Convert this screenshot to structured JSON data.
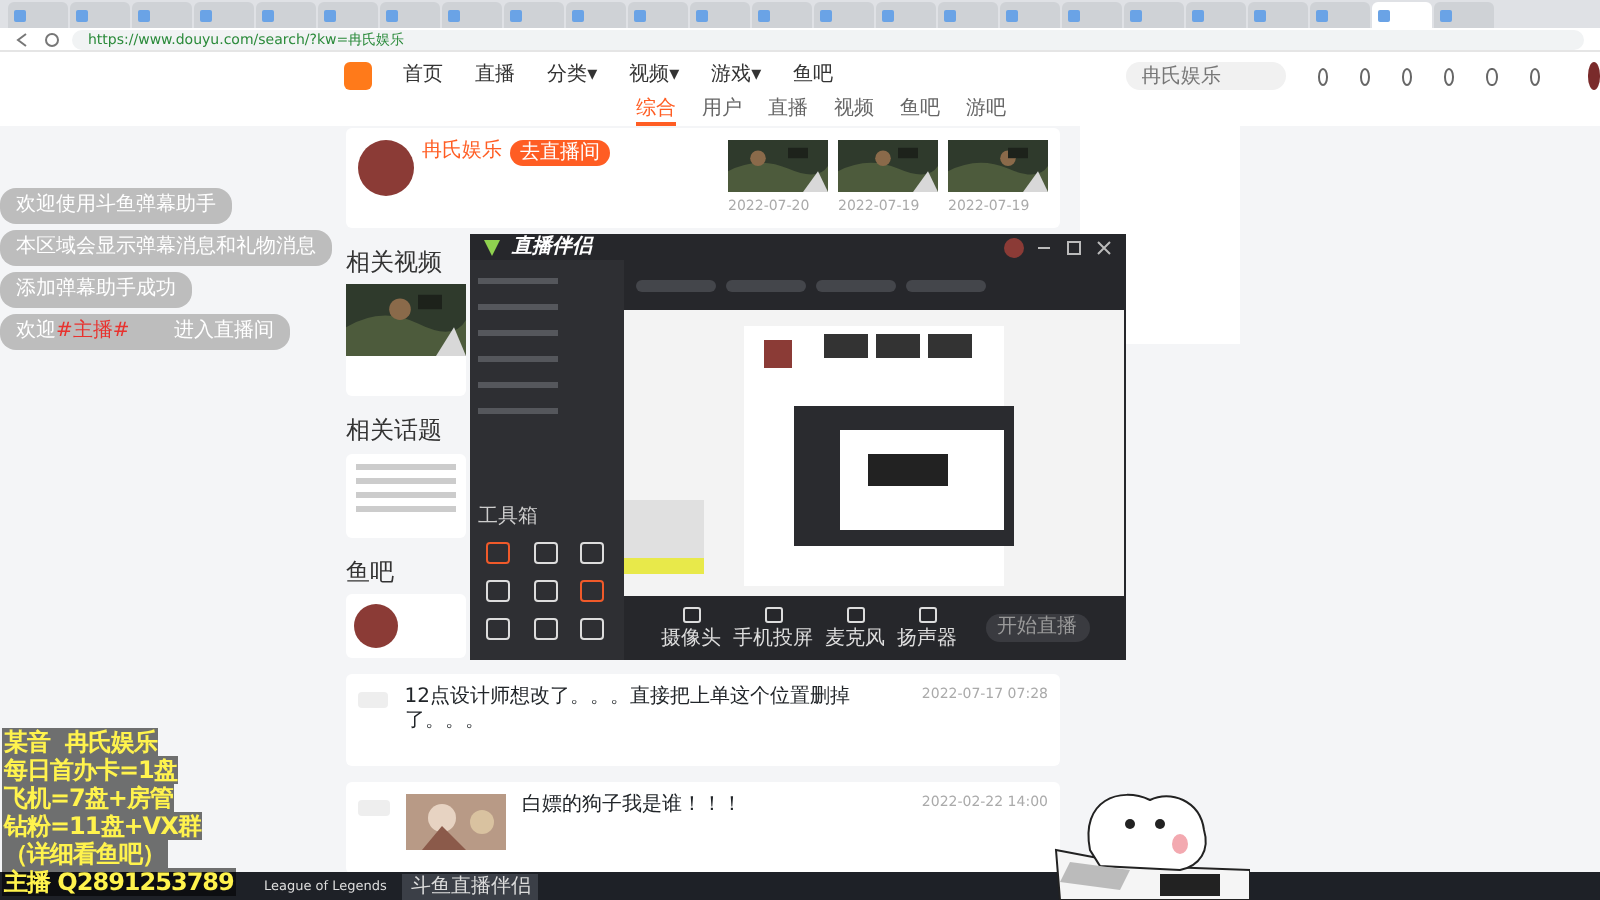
{
  "browser": {
    "tabs": [
      {
        "selected": false
      },
      {
        "selected": false
      },
      {
        "selected": false
      },
      {
        "selected": false
      },
      {
        "selected": false
      },
      {
        "selected": false
      },
      {
        "selected": false
      },
      {
        "selected": false
      },
      {
        "selected": false
      },
      {
        "selected": false
      },
      {
        "selected": false
      },
      {
        "selected": false
      },
      {
        "selected": false
      },
      {
        "selected": false
      },
      {
        "selected": false
      },
      {
        "selected": false
      },
      {
        "selected": false
      },
      {
        "selected": false
      },
      {
        "selected": false
      },
      {
        "selected": false
      },
      {
        "selected": false
      },
      {
        "selected": false
      },
      {
        "selected": true
      },
      {
        "selected": false
      }
    ],
    "url": "https://www.douyu.com/search/?kw=冉氏娱乐"
  },
  "site_header": {
    "nav": [
      {
        "label": "首页"
      },
      {
        "label": "直播"
      },
      {
        "label": "分类",
        "caret": "▾"
      },
      {
        "label": "视频",
        "caret": "▾"
      },
      {
        "label": "游戏",
        "caret": "▾"
      },
      {
        "label": "鱼吧"
      }
    ],
    "search": {
      "value": "冉氏娱乐"
    }
  },
  "result_tabs": [
    {
      "label": "综合",
      "selected": true
    },
    {
      "label": "用户",
      "selected": false
    },
    {
      "label": "直播",
      "selected": false
    },
    {
      "label": "视频",
      "selected": false
    },
    {
      "label": "鱼吧",
      "selected": false
    },
    {
      "label": "游吧",
      "selected": false
    }
  ],
  "streamer": {
    "name": "冉氏娱乐",
    "button": "去直播间"
  },
  "videos": [
    {
      "date": "2022-07-20"
    },
    {
      "date": "2022-07-19"
    },
    {
      "date": "2022-07-19"
    }
  ],
  "sections": [
    "相关视频",
    "相关话题",
    "鱼吧"
  ],
  "chat": [
    {
      "text": "欢迎使用斗鱼弹幕助手"
    },
    {
      "text": "本区域会显示弹幕消息和礼物消息"
    },
    {
      "text": "添加弹幕助手成功"
    },
    {
      "text": "欢迎",
      "highlight": "#主播#",
      "after": "进入直播间"
    }
  ],
  "posts": [
    {
      "title": "12点设计师想改了。。。直接把上单这个位置删掉了。。。",
      "date": "2022-07-17 07:28"
    },
    {
      "title": "白嫖的狗子我是谁！！！",
      "date": "2022-02-22 14:00"
    }
  ],
  "studio": {
    "title": "直播伴侣",
    "toolbox": "工具箱",
    "tools": [
      "摄像头",
      "手机投屏",
      "麦克风",
      "扬声器"
    ],
    "start_button": "开始直播"
  },
  "overlay": [
    "某音  冉氏娱乐",
    "每日首办卡=1盘",
    "飞机=7盘+房管",
    "钻粉=11盘+VX群",
    "（详细看鱼吧）",
    "主播 Q2891253789"
  ],
  "taskbar": {
    "apps": [
      {
        "label": "League of Legends",
        "active": false
      },
      {
        "label": "斗鱼直播伴侣",
        "active": true
      }
    ]
  }
}
